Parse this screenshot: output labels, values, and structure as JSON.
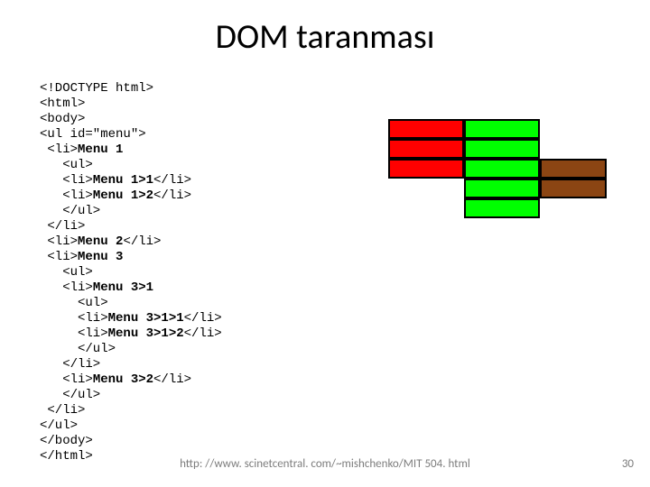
{
  "title": "DOM taranması",
  "code": {
    "l0": "<!DOCTYPE html>",
    "l1": "<html>",
    "l2": "<body>",
    "l3": "<ul id=\"menu\">",
    "l4a": " <li>",
    "l4b": "Menu 1",
    "l5": "   <ul>",
    "l6a": "   <li>",
    "l6b": "Menu 1>1",
    "l6c": "</li>",
    "l7a": "   <li>",
    "l7b": "Menu 1>2",
    "l7c": "</li>",
    "l8": "   </ul>",
    "l9": " </li>",
    "l10a": " <li>",
    "l10b": "Menu 2",
    "l10c": "</li>",
    "l11a": " <li>",
    "l11b": "Menu 3",
    "l12": "   <ul>",
    "l13a": "   <li>",
    "l13b": "Menu 3>1",
    "l14": "     <ul>",
    "l15a": "     <li>",
    "l15b": "Menu 3>1>1",
    "l15c": "</li>",
    "l16a": "     <li>",
    "l16b": "Menu 3>1>2",
    "l16c": "</li>",
    "l17": "     </ul>",
    "l18": "   </li>",
    "l19a": "   <li>",
    "l19b": "Menu 3>2",
    "l19c": "</li>",
    "l20": "   </ul>",
    "l21": " </li>",
    "l22": "</ul>",
    "l23": "</body>",
    "l24": "</html>"
  },
  "footer": {
    "url": "http: //www. scinetcentral. com/~mishchenko/MIT 504. html",
    "page": "30"
  }
}
